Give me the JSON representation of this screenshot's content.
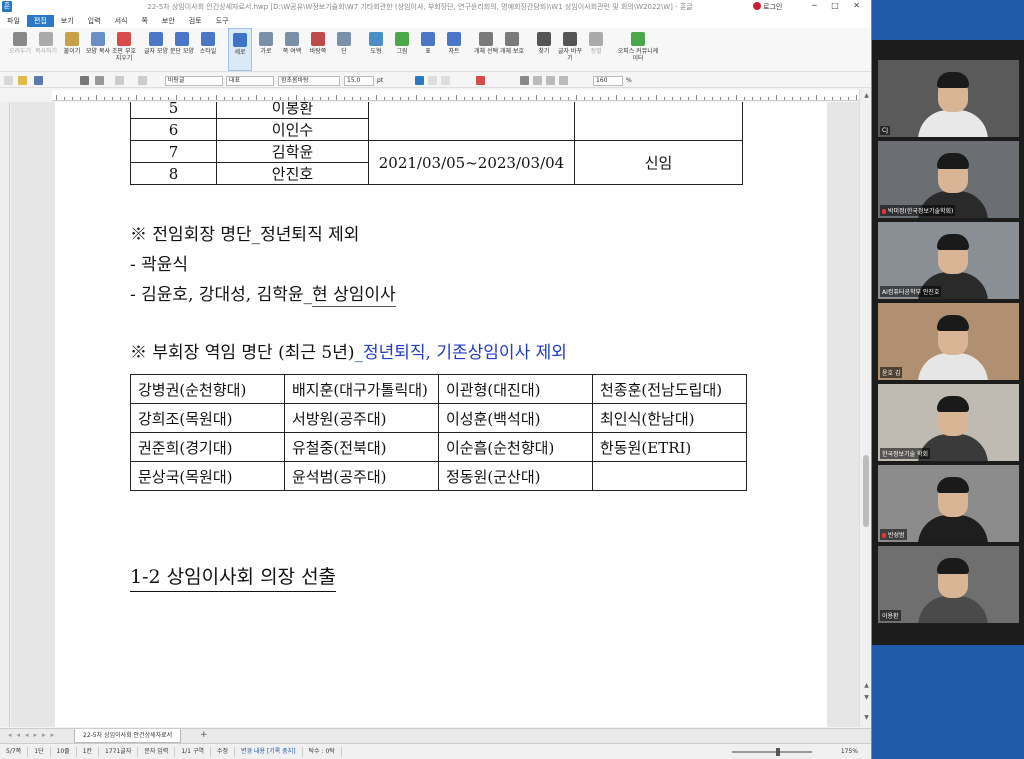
{
  "app": {
    "title": "22-5차 상임이사회 안건상세자료서.hwp [D:\\W공유\\W정보기술회\\W7 기타회관한 (상임이사, 부회장단, 연구윤리회의, 명예회장간담회)\\W1 상임이사회관련 및 회의\\W2022\\W] - 훈글",
    "login_label": "로그인",
    "logo": "훈"
  },
  "menu": {
    "items": [
      "파일",
      "편집",
      "보기",
      "입력",
      "서식",
      "쪽",
      "보안",
      "검토",
      "도구"
    ],
    "active_index": 1
  },
  "ribbon": {
    "buttons": [
      {
        "label": "오려두기",
        "color": "#888888",
        "dim": true
      },
      {
        "label": "복사하기",
        "color": "#aaaaaa",
        "dim": true
      },
      {
        "label": "붙이기",
        "color": "#caa04a",
        "dim": false
      },
      {
        "label": "모양 복사",
        "color": "#6a8fc7",
        "dim": false
      },
      {
        "label": "조판 부호 지우기",
        "color": "#d84b4b",
        "dim": false
      },
      {
        "label": "글자 모양",
        "color": "#4a78c7",
        "dim": false
      },
      {
        "label": "문단 모양",
        "color": "#4a78c7",
        "dim": false
      },
      {
        "label": "스타일",
        "color": "#4a78c7",
        "dim": false
      },
      {
        "label": "세로",
        "color": "#3d74c5",
        "dim": false,
        "selected": true
      },
      {
        "label": "가로",
        "color": "#7a8fa8",
        "dim": false
      },
      {
        "label": "쪽 여백",
        "color": "#7a8fa8",
        "dim": false
      },
      {
        "label": "바탕쪽",
        "color": "#c04a4a",
        "dim": false
      },
      {
        "label": "단",
        "color": "#7a8fa8",
        "dim": false
      },
      {
        "label": "도형",
        "color": "#4a8fc7",
        "dim": false
      },
      {
        "label": "그림",
        "color": "#4aa84a",
        "dim": false
      },
      {
        "label": "표",
        "color": "#4a78c7",
        "dim": false
      },
      {
        "label": "차트",
        "color": "#4a78c7",
        "dim": false
      },
      {
        "label": "개체 선택",
        "color": "#7a7a7a",
        "dim": false
      },
      {
        "label": "개체 보호",
        "color": "#7a7a7a",
        "dim": false
      },
      {
        "label": "찾기",
        "color": "#555555",
        "dim": false
      },
      {
        "label": "글자 바꾸기",
        "color": "#555555",
        "dim": false
      },
      {
        "label": "정렬",
        "color": "#aaaaaa",
        "dim": true
      },
      {
        "label": "오피스 커뮤니케이터",
        "color": "#4aa84a",
        "dim": false
      }
    ]
  },
  "format_bar": {
    "style": "바탕글",
    "lang": "대표",
    "font": "함초롬바탕",
    "size": "15.0",
    "size_unit": "pt",
    "zoom": "160",
    "zoom_unit": "%"
  },
  "document": {
    "table1": {
      "rows": [
        {
          "num": "5",
          "name": "이봉환"
        },
        {
          "num": "6",
          "name": "이인수"
        },
        {
          "num": "7",
          "name": "김학윤"
        },
        {
          "num": "8",
          "name": "안진호"
        }
      ],
      "period": "2021/03/05~2023/03/04",
      "status": "신임"
    },
    "section1": {
      "heading": "※ 전임회장 명단_정년퇴직 제외",
      "item1": " - 곽윤식",
      "item2_pre": " - 김윤호, 강대성, 김학윤_",
      "item2_ul": "현 상임이사"
    },
    "section2": {
      "heading_pre": "※ 부회장 역임 명단 (최근 5년)",
      "heading_blue": "_정년퇴직, 기존상임이사 제외"
    },
    "table2": [
      [
        "강병권(순천향대)",
        "배지훈(대구가톨릭대)",
        "이관형(대진대)",
        "천종훈(전남도립대)"
      ],
      [
        "강희조(목원대)",
        "서방원(공주대)",
        "이성훈(백석대)",
        "최인식(한남대)"
      ],
      [
        "권준희(경기대)",
        "유철중(전북대)",
        "이순흠(순천향대)",
        "한동원(ETRI)"
      ],
      [
        "문상국(목원대)",
        "윤석범(공주대)",
        "정동원(군산대)",
        ""
      ]
    ],
    "heading": "1-2 상임이사회 의장 선출"
  },
  "tabs": {
    "active": "22-5차 상임이사회 안건상세자료서",
    "plus": "+"
  },
  "status": {
    "items": [
      "5/7쪽",
      "1단",
      "10줄",
      "1칸",
      "1771글자",
      "문자 입력",
      "1/1 구역",
      "수정"
    ],
    "track_changes": "변경 내용 [기록 중지]",
    "page_count": "탁수 : 0탁",
    "zoom": "175%"
  },
  "videos": [
    {
      "name": "CJ",
      "bg": "#5a5a5a",
      "shirt": "#e8e8e8",
      "muted": false,
      "active": false
    },
    {
      "name": "박미정(한국정보기술학회)",
      "bg": "#6b6e73",
      "shirt": "#2a2a2a",
      "muted": true,
      "active": false
    },
    {
      "name": "AI컴퓨터공학부 안진호",
      "bg": "#8a8f96",
      "shirt": "#2a2a2a",
      "muted": false,
      "active": false
    },
    {
      "name": "윤호 김",
      "bg": "#b09070",
      "shirt": "#e6e6e6",
      "muted": false,
      "active": true
    },
    {
      "name": "한국정보기술 학회",
      "bg": "#bfbab2",
      "shirt": "#3a3a3a",
      "muted": false,
      "active": false
    },
    {
      "name": "반성범",
      "bg": "#8c8c8c",
      "shirt": "#1e1e1e",
      "muted": true,
      "active": false
    },
    {
      "name": "이용환",
      "bg": "#6f6f6f",
      "shirt": "#4a4a4a",
      "muted": false,
      "active": false
    }
  ],
  "colors": {
    "accent": "#2b78c5",
    "blue_text": "#1e3cc8",
    "desktop": "#1e5aa8"
  }
}
